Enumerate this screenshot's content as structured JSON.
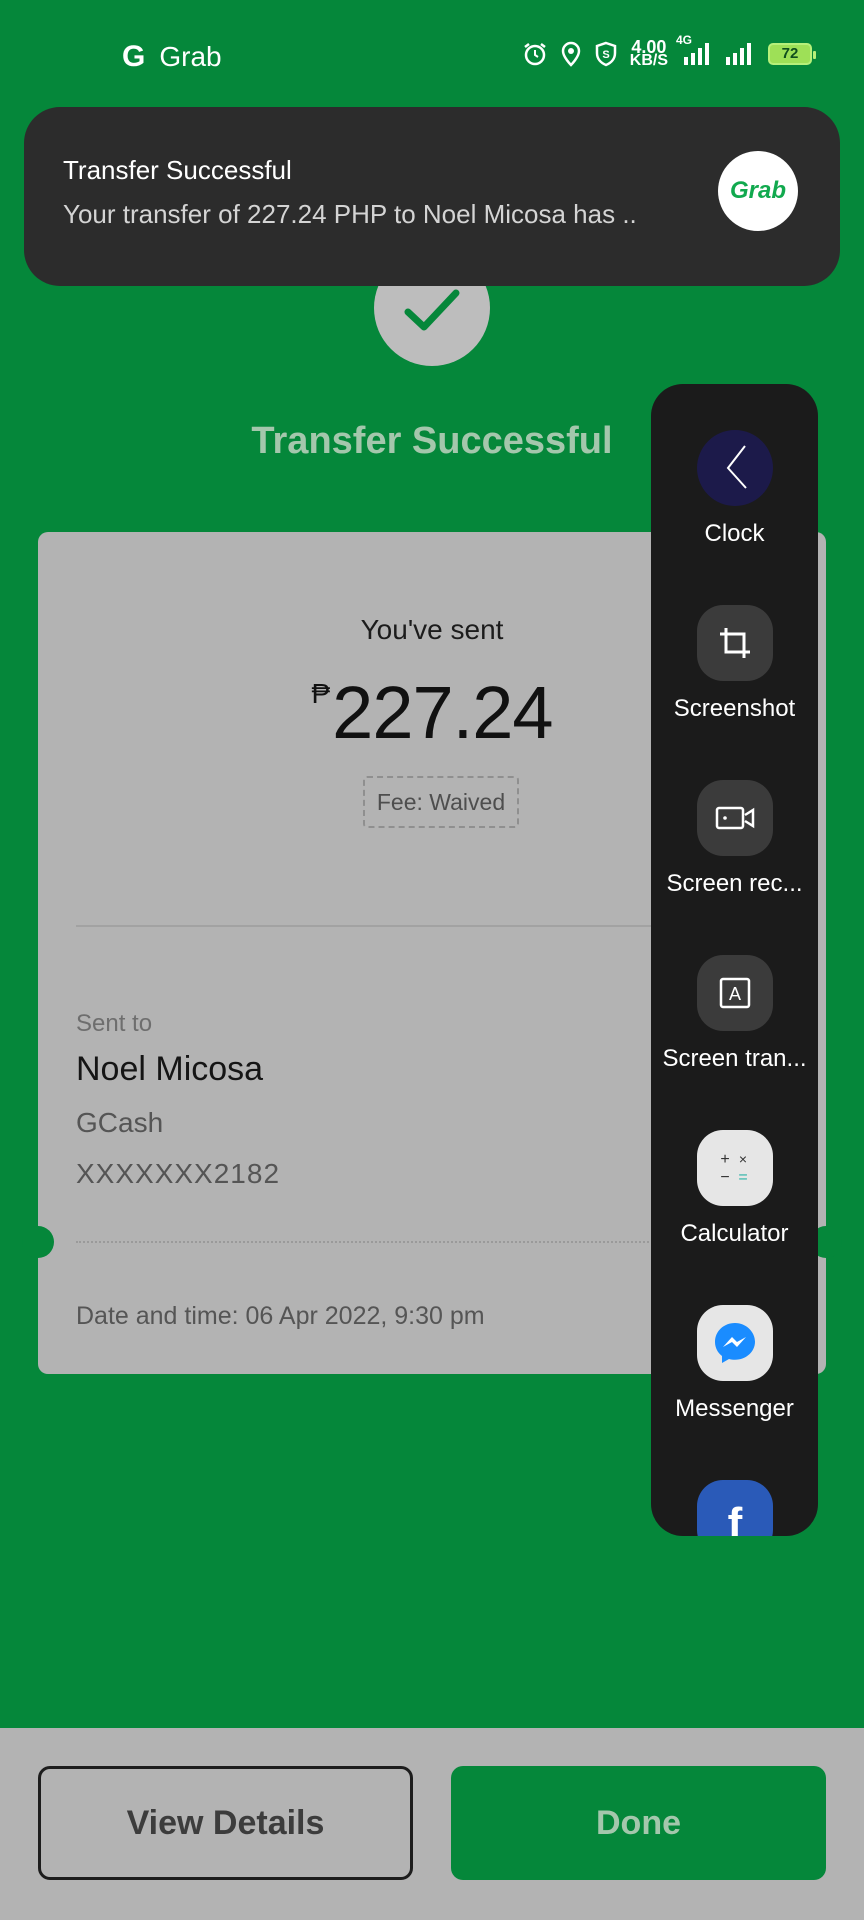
{
  "status_bar": {
    "app_letter": "G",
    "app_name": "Grab",
    "speed_value": "4.00",
    "speed_unit": "KB/S",
    "network": "4G",
    "battery": "72"
  },
  "notification": {
    "title": "Transfer Successful",
    "body": "Your transfer of 227.24 PHP to Noel Micosa has ..",
    "logo_text": "Grab"
  },
  "page": {
    "title": "Transfer Successful"
  },
  "receipt": {
    "sent_label": "You've sent",
    "currency_symbol": "₱",
    "amount": "227.24",
    "fee": "Fee: Waived",
    "sent_to_label": "Sent to",
    "recipient_name": "Noel Micosa",
    "provider": "GCash",
    "account_number": "XXXXXXX2182",
    "datetime": "Date and time: 06 Apr 2022, 9:30 pm"
  },
  "side_panel": {
    "items": [
      {
        "label": "Clock",
        "icon": "clock-icon"
      },
      {
        "label": "Screenshot",
        "icon": "crop-icon"
      },
      {
        "label": "Screen rec...",
        "icon": "video-record-icon"
      },
      {
        "label": "Screen tran...",
        "icon": "translate-icon"
      },
      {
        "label": "Calculator",
        "icon": "calculator-icon"
      },
      {
        "label": "Messenger",
        "icon": "messenger-icon"
      }
    ]
  },
  "actions": {
    "view_details": "View Details",
    "done": "Done"
  },
  "colors": {
    "background": "#05873a",
    "overlay_grey": "#b3b3b3",
    "panel": "#1b1b1b"
  }
}
